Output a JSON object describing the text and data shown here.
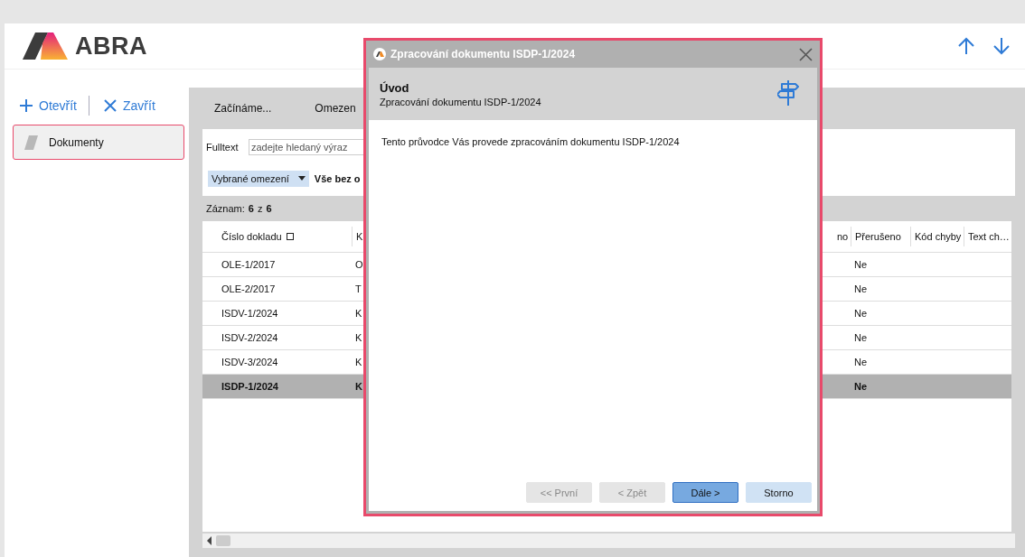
{
  "app": {
    "logo_text": "ABRA"
  },
  "nav": [
    {
      "kind": "up"
    },
    {
      "kind": "down"
    }
  ],
  "sidebar": {
    "actions": [
      {
        "kind": "open",
        "label": "Otevřít"
      },
      {
        "kind": "close",
        "label": "Zavřít"
      }
    ],
    "items": [
      {
        "label": "Dokumenty",
        "selected": true
      }
    ]
  },
  "tabs": [
    {
      "label": "Začínáme..."
    },
    {
      "label": "Omezen"
    }
  ],
  "filter": {
    "fulltext_label": "Fulltext",
    "placeholder": "zadejte hledaný výraz",
    "dropdown": "Vybrané omezení",
    "filter_name": "Vše bez o"
  },
  "record_count": {
    "label": "Záznam:",
    "current": "6",
    "separator": "z",
    "total": "6"
  },
  "table": {
    "columns": [
      "Číslo dokladu",
      "K",
      "no",
      "Přerušeno",
      "Kód chyby",
      "Text ch…"
    ],
    "rows": [
      {
        "number": "OLE-1/2017",
        "column_2": "O",
        "interrupted": "Ne",
        "selected": false
      },
      {
        "number": "OLE-2/2017",
        "column_2": "T",
        "interrupted": "Ne",
        "selected": false
      },
      {
        "number": "ISDV-1/2024",
        "column_2": "K",
        "interrupted": "Ne",
        "selected": false
      },
      {
        "number": "ISDV-2/2024",
        "column_2": "K",
        "interrupted": "Ne",
        "selected": false
      },
      {
        "number": "ISDV-3/2024",
        "column_2": "K",
        "interrupted": "Ne",
        "selected": false
      },
      {
        "number": "ISDP-1/2024",
        "column_2": "K",
        "interrupted": "Ne",
        "selected": true
      }
    ]
  },
  "dialog": {
    "title": "Zpracování dokumentu ISDP-1/2024",
    "step_title": "Úvod",
    "step_subtitle": "Zpracování dokumentu ISDP-1/2024",
    "body": "Tento průvodce Vás provede zpracováním dokumentu ISDP-1/2024",
    "buttons": [
      {
        "label": "<< První",
        "disabled": true,
        "default": false
      },
      {
        "label": "< Zpět",
        "disabled": true,
        "default": false
      },
      {
        "label": "Dále >",
        "disabled": false,
        "default": true
      },
      {
        "label": "Storno",
        "disabled": false,
        "default": false
      }
    ]
  }
}
